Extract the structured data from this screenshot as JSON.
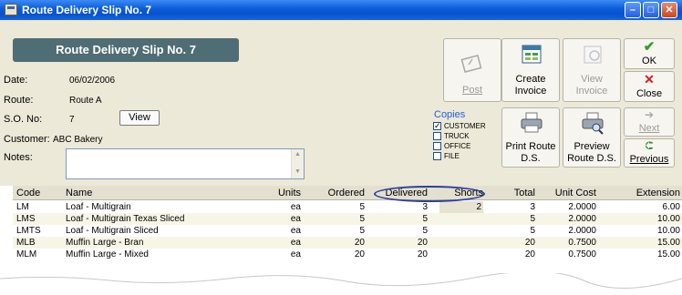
{
  "window": {
    "title": "Route Delivery Slip No. 7"
  },
  "banner": "Route Delivery Slip No. 7",
  "form": {
    "date_label": "Date:",
    "date_value": "06/02/2006",
    "route_label": "Route:",
    "route_value": "Route A",
    "so_label": "S.O. No:",
    "so_value": "7",
    "view_label": "View",
    "customer_label": "Customer:",
    "customer_value": "ABC Bakery",
    "notes_label": "Notes:"
  },
  "copies": {
    "title": "Copies",
    "items": [
      {
        "label": "CUSTOMER",
        "checked": true
      },
      {
        "label": "TRUCK",
        "checked": false
      },
      {
        "label": "OFFICE",
        "checked": false
      },
      {
        "label": "FILE",
        "checked": false
      }
    ]
  },
  "toolbar": {
    "post": "Post",
    "create_invoice_1": "Create",
    "create_invoice_2": "Invoice",
    "view_invoice_1": "View",
    "view_invoice_2": "Invoice",
    "ok": "OK",
    "close": "Close",
    "next": "Next",
    "print_1": "Print Route",
    "print_2": "D.S.",
    "preview_1": "Preview",
    "preview_2": "Route D.S.",
    "previous": "Previous"
  },
  "table": {
    "headers": [
      "Code",
      "Name",
      "Units",
      "Ordered",
      "Delivered",
      "Shorts",
      "Total",
      "Unit Cost",
      "Extension"
    ],
    "rows": [
      [
        "LM",
        "Loaf - Multigrain",
        "ea",
        "5",
        "3",
        "2",
        "3",
        "2.0000",
        "6.00"
      ],
      [
        "LMS",
        "Loaf - Multigrain Texas Sliced",
        "ea",
        "5",
        "5",
        "",
        "5",
        "2.0000",
        "10.00"
      ],
      [
        "LMTS",
        "Loaf - Multigrain Sliced",
        "ea",
        "5",
        "5",
        "",
        "5",
        "2.0000",
        "10.00"
      ],
      [
        "MLB",
        "Muffin Large - Bran",
        "ea",
        "20",
        "20",
        "",
        "20",
        "0.7500",
        "15.00"
      ],
      [
        "MLM",
        "Muffin Large - Mixed",
        "ea",
        "20",
        "20",
        "",
        "20",
        "0.7500",
        "15.00"
      ]
    ]
  },
  "colors": {
    "titlebar": "#0a5ad8",
    "banner": "#4f6d74",
    "form_bg": "#ece9d8",
    "highlight_oval": "#2a3fa0"
  }
}
